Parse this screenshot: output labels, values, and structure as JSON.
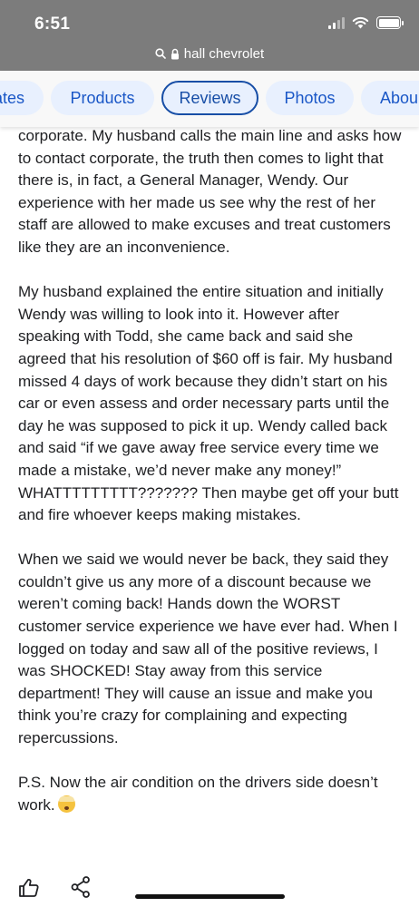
{
  "status_bar": {
    "time": "6:51",
    "icons": [
      "cellular-signal-icon",
      "wifi-icon",
      "battery-icon"
    ]
  },
  "browser": {
    "url": "hall chevrolet",
    "icons": [
      "search-icon",
      "lock-icon"
    ]
  },
  "tabs": [
    {
      "label": "ates",
      "active": false
    },
    {
      "label": "Products",
      "active": false
    },
    {
      "label": "Reviews",
      "active": true
    },
    {
      "label": "Photos",
      "active": false
    },
    {
      "label": "Abou",
      "active": false
    }
  ],
  "review": {
    "paragraphs": [
      "corporate. My husband calls the main line and asks how to contact corporate, the truth then comes to light that there is, in fact, a General Manager, Wendy. Our experience with her made us see why the rest of her staff are allowed to make excuses and treat customers like they are an inconvenience.",
      "My husband explained the entire situation and initially Wendy was willing to look into it. However after speaking with Todd, she came back and said she agreed that his resolution of $60 off is fair. My husband missed 4 days of work because they didn’t start on his car or even assess and order necessary parts until the day he was supposed to pick it up. Wendy called back and said “if we gave away free service every time we made a mistake, we’d never make any money!” WHATTTTTTTTT??????? Then maybe get off your butt and fire whoever keeps making mistakes.",
      "When we said we would never be back, they said they couldn’t give us any more of a discount because we weren’t coming back! Hands down the WORST customer service experience we have ever had. When I logged on today and saw all of the positive reviews, I was SHOCKED! Stay away from this service department! They will cause an issue and make you think you’re crazy for complaining and expecting repercussions.",
      "P.S. Now the air condition on the drivers side doesn’t work."
    ],
    "emoji": "exploding-head-emoji"
  },
  "actions": {
    "icons": [
      "thumbs-up-icon",
      "share-icon"
    ]
  },
  "colors": {
    "chrome_gray": "#7c7c7c",
    "chip_background": "#e8f0fe",
    "chip_text": "#1a57c7",
    "active_border": "#174ea6"
  }
}
